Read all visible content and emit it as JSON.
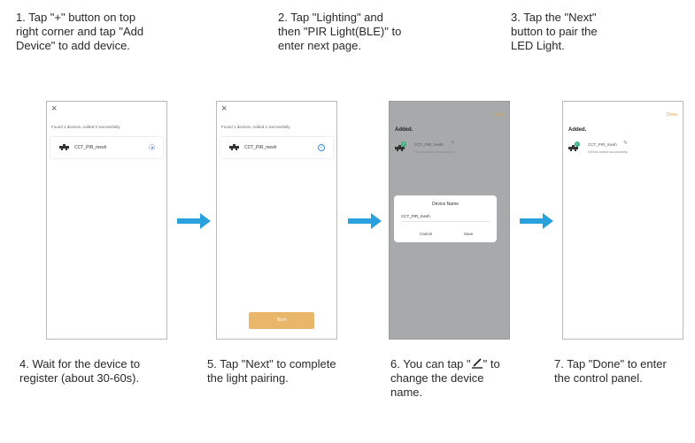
{
  "instructions_top": [
    "1. Tap \"+\" button on top\nright corner and tap \"Add\nDevice\" to add device.",
    "2. Tap \"Lighting\" and\nthen \"PIR Light(BLE)\" to\nenter next page.",
    "3. Tap the \"Next\"\nbutton to pair the\nLED Light."
  ],
  "instructions_bottom": {
    "step4": "4. Wait for the device to\n    register (about 30-60s).",
    "step5": "5. Tap \"Next\" to complete\n    the light pairing.",
    "step6_before": "6. You can tap \"",
    "step6_after": "\" to\n    change the device\n    name.",
    "step7": "7. Tap \"Done\" to enter\n    the control panel."
  },
  "screen1": {
    "close_glyph": "×",
    "status": "Found 1 devices. Added 0 successfully.",
    "device_name": "CCT_PIR_mesh"
  },
  "screen2": {
    "close_glyph": "×",
    "status": "Found 1 devices. Added 1 successfully.",
    "device_name": "CCT_PIR_mesh",
    "check_glyph": "✓",
    "next_label": "Next"
  },
  "screen3": {
    "done_label": "Done",
    "added_title": "Added.",
    "device_name": "CCT_PIR_mesh",
    "added_sub": "Device added successfully",
    "dialog_title": "Device Name",
    "dialog_value": "CCT_PIR_mesh",
    "cancel_label": "Cancel",
    "save_label": "Save"
  },
  "screen4": {
    "done_label": "Done",
    "added_title": "Added.",
    "device_name": "CCT_PIR_mesh",
    "added_sub": "Device added successfully"
  },
  "icons": {
    "arrow": "right-arrow-icon",
    "pencil": "pencil-icon",
    "light": "ceiling-light-icon",
    "check": "check-icon"
  },
  "colors": {
    "arrow": "#2aa0dc",
    "next_button": "#e8b769",
    "done": "#d9a441",
    "gray_overlay": "#a7a9ab",
    "check": "#2f8fe8",
    "badge": "#3ab07c"
  }
}
